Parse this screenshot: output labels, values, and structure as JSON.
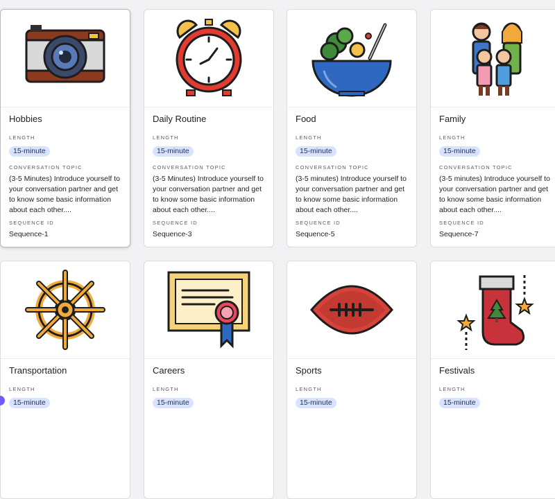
{
  "labels": {
    "length": "LENGTH",
    "topic": "CONVERSATION TOPIC",
    "sequence": "SEQUENCE ID"
  },
  "cards": [
    {
      "title": "Hobbies",
      "length": "15-minute",
      "topic": "(3-5 Minutes) Introduce yourself to your conversation partner and get to know some basic information about each other....",
      "sequence": "Sequence-1",
      "icon": "camera-icon"
    },
    {
      "title": "Daily Routine",
      "length": "15-minute",
      "topic": "(3-5 Minutes) Introduce yourself to your conversation partner and get to know some basic information about each other....",
      "sequence": "Sequence-3",
      "icon": "alarm-clock-icon"
    },
    {
      "title": "Food",
      "length": "15-minute",
      "topic": "(3-5 minutes) Introduce yourself to your conversation partner and get to know some basic information about each other....",
      "sequence": "Sequence-5",
      "icon": "salad-bowl-icon"
    },
    {
      "title": "Family",
      "length": "15-minute",
      "topic": "(3-5 minutes) Introduce yourself to your conversation partner and get to know some basic information about each other....",
      "sequence": "Sequence-7",
      "icon": "family-icon"
    },
    {
      "title": "Transportation",
      "length": "15-minute",
      "icon": "ship-wheel-icon"
    },
    {
      "title": "Careers",
      "length": "15-minute",
      "icon": "certificate-icon"
    },
    {
      "title": "Sports",
      "length": "15-minute",
      "icon": "football-icon"
    },
    {
      "title": "Festivals",
      "length": "15-minute",
      "icon": "christmas-stocking-icon"
    }
  ]
}
